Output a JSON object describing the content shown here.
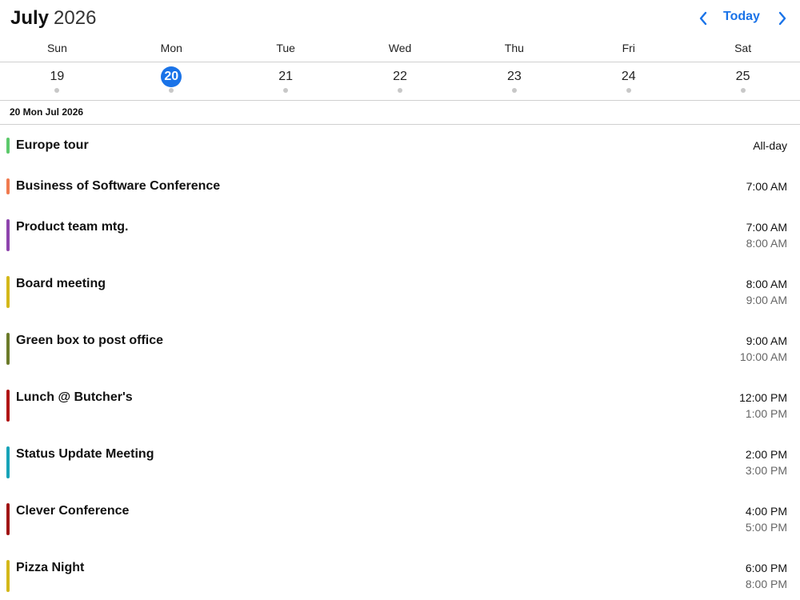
{
  "header": {
    "month": "July",
    "year": "2026",
    "today_label": "Today",
    "prev_icon": "chevron-left-icon",
    "next_icon": "chevron-right-icon",
    "accent_color": "#1a73e8"
  },
  "weekdays": [
    "Sun",
    "Mon",
    "Tue",
    "Wed",
    "Thu",
    "Fri",
    "Sat"
  ],
  "dates": [
    {
      "num": "19",
      "selected": false
    },
    {
      "num": "20",
      "selected": true
    },
    {
      "num": "21",
      "selected": false
    },
    {
      "num": "22",
      "selected": false
    },
    {
      "num": "23",
      "selected": false
    },
    {
      "num": "24",
      "selected": false
    },
    {
      "num": "25",
      "selected": false
    }
  ],
  "agenda": {
    "date_label": "20 Mon Jul 2026",
    "events": [
      {
        "title": "Europe tour",
        "start": "All-day",
        "end": "",
        "color": "#5cc96b"
      },
      {
        "title": "Business of Software Conference",
        "start": "7:00 AM",
        "end": "",
        "color": "#f07a4f"
      },
      {
        "title": "Product team mtg.",
        "start": "7:00 AM",
        "end": "8:00 AM",
        "color": "#8e44ad"
      },
      {
        "title": "Board meeting",
        "start": "8:00 AM",
        "end": "9:00 AM",
        "color": "#d4b81a"
      },
      {
        "title": "Green box to post office",
        "start": "9:00 AM",
        "end": "10:00 AM",
        "color": "#6b7a2a"
      },
      {
        "title": "Lunch @ Butcher's",
        "start": "12:00 PM",
        "end": "1:00 PM",
        "color": "#b01515"
      },
      {
        "title": "Status Update Meeting",
        "start": "2:00 PM",
        "end": "3:00 PM",
        "color": "#17a3b8"
      },
      {
        "title": "Clever Conference",
        "start": "4:00 PM",
        "end": "5:00 PM",
        "color": "#a01515"
      },
      {
        "title": "Pizza Night",
        "start": "6:00 PM",
        "end": "8:00 PM",
        "color": "#d4b81a"
      }
    ]
  }
}
